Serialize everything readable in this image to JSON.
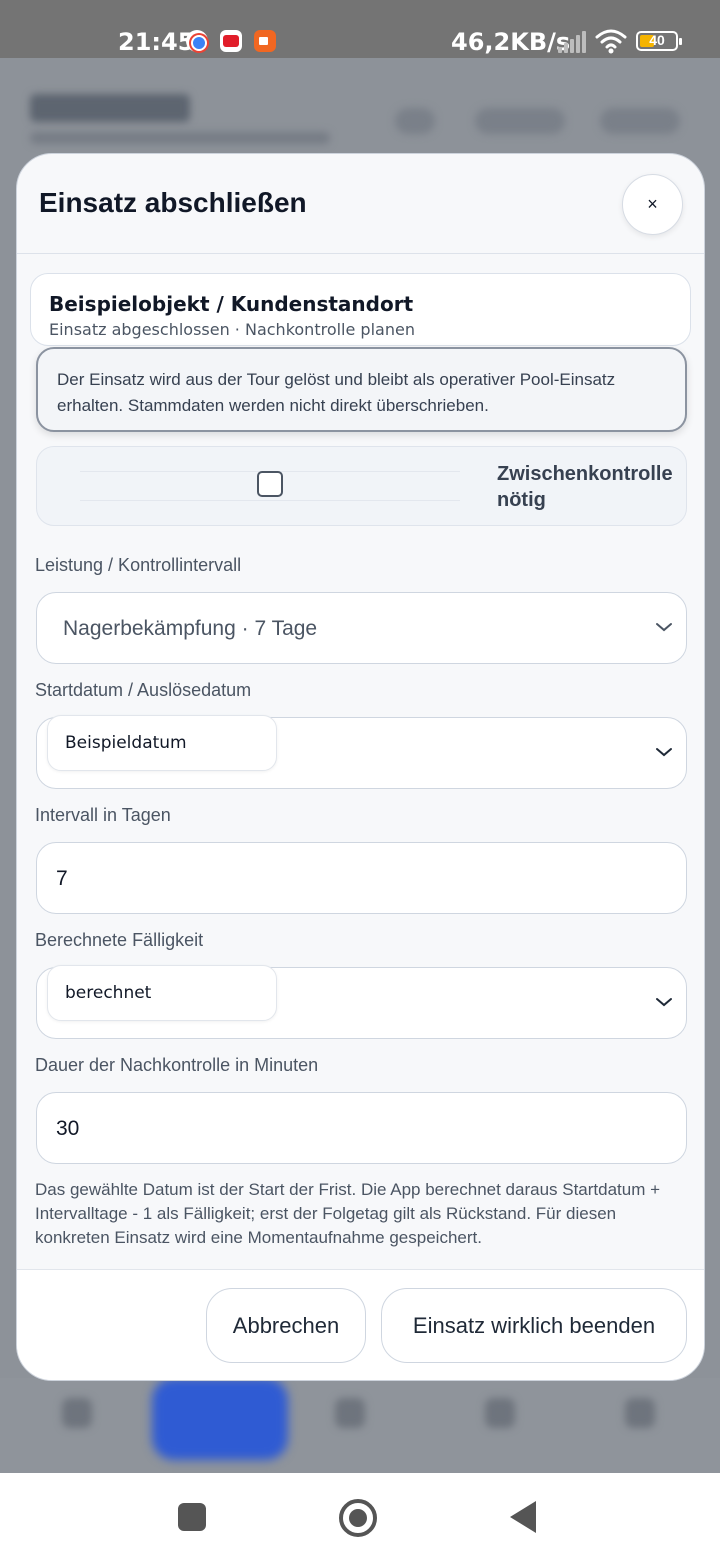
{
  "status_bar": {
    "time": "21:45",
    "network_speed": "46,2KB/s",
    "battery": "40"
  },
  "modal": {
    "title": "Einsatz abschließen",
    "close_label": "×",
    "object": {
      "name": "Beispielobjekt / Kundenstandort",
      "status": "Einsatz abgeschlossen · Nachkontrolle planen"
    },
    "info_text": "Der Einsatz wird aus der Tour gelöst und bleibt als operativer Pool-Einsatz erhalten. Stammdaten werden nicht direkt überschrieben.",
    "intermediate_check": {
      "label": "Zwischenkontrolle nötig",
      "checked": false
    },
    "service_interval": {
      "label": "Leistung / Kontrollintervall",
      "value": "Nagerbekämpfung · 7 Tage"
    },
    "start_date": {
      "label": "Startdatum / Auslösedatum",
      "value": "Beispieldatum"
    },
    "interval_days": {
      "label": "Intervall in Tagen",
      "value": "7"
    },
    "due_date": {
      "label": "Berechnete Fälligkeit",
      "value": "berechnet"
    },
    "duration": {
      "label": "Dauer der Nachkontrolle in Minuten",
      "value": "30"
    },
    "help_text": "Das gewählte Datum ist der Start der Frist. Die App berechnet daraus Startdatum + Intervalltage - 1 als Fälligkeit; erst der Folgetag gilt als Rückstand. Für diesen konkreten Einsatz wird eine Momentaufnahme gespeichert.",
    "buttons": {
      "cancel": "Abbrechen",
      "confirm": "Einsatz wirklich beenden"
    }
  },
  "colors": {
    "status_bar": "#747474",
    "modal_bg": "#f7f8fa",
    "backdrop": "#8d9299",
    "accent": "#2f5bd3"
  }
}
